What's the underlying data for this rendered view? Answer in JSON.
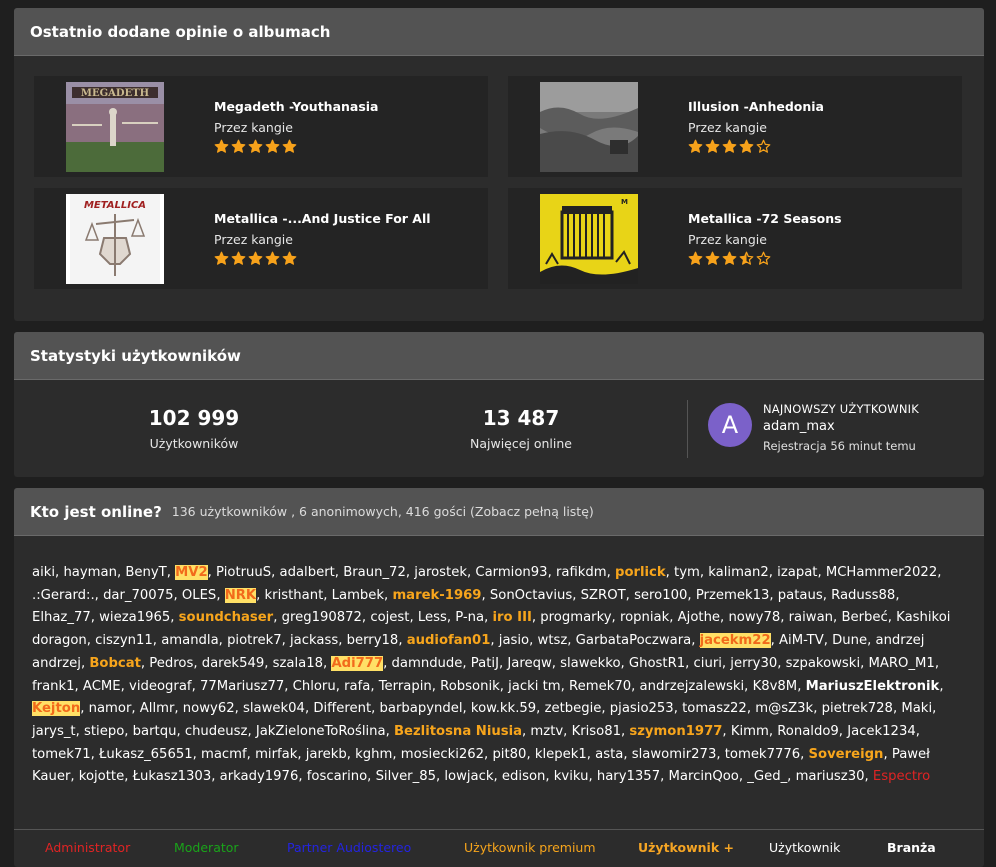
{
  "reviews": {
    "title": "Ostatnio dodane opinie o albumach",
    "items": [
      {
        "title": "Megadeth -Youthanasia",
        "author": "Przez kangie",
        "rating": 5
      },
      {
        "title": "Illusion -Anhedonia",
        "author": "Przez kangie",
        "rating": 4
      },
      {
        "title": "Metallica -...And Justice For All",
        "author": "Przez kangie",
        "rating": 5
      },
      {
        "title": "Metallica -72 Seasons",
        "author": "Przez kangie",
        "rating": 3.5
      }
    ]
  },
  "stats": {
    "title": "Statystyki użytkowników",
    "users_count": "102 999",
    "users_label": "Użytkowników",
    "online_max": "13 487",
    "online_max_label": "Najwięcej online",
    "newest_label": "NAJNOWSZY UŻYTKOWNIK",
    "newest_initial": "A",
    "newest_name": "adam_max",
    "newest_registered": "Rejestracja 56 minut temu"
  },
  "online": {
    "title": "Kto jest online?",
    "summary": "136 użytkowników , 6 anonimowych, 416 gości (Zobacz pełną listę)",
    "users": [
      {
        "n": "aiki"
      },
      {
        "n": "hayman"
      },
      {
        "n": "BenyT"
      },
      {
        "n": "MV2",
        "t": "premium hl"
      },
      {
        "n": "PiotruuS"
      },
      {
        "n": "adalbert"
      },
      {
        "n": "Braun_72"
      },
      {
        "n": "jarostek"
      },
      {
        "n": "Carmion93"
      },
      {
        "n": "rafikdm"
      },
      {
        "n": "porlick",
        "t": "premium"
      },
      {
        "n": "tym"
      },
      {
        "n": "kaliman2"
      },
      {
        "n": "izapat"
      },
      {
        "n": "MCHammer2022"
      },
      {
        "n": ".:Gerard:."
      },
      {
        "n": "dar_70075"
      },
      {
        "n": "OLES"
      },
      {
        "n": "NRK",
        "t": "premium hl"
      },
      {
        "n": "kristhant"
      },
      {
        "n": "Lambek"
      },
      {
        "n": "marek-1969",
        "t": "premium"
      },
      {
        "n": "SonOctavius"
      },
      {
        "n": "SZROT"
      },
      {
        "n": "sero100"
      },
      {
        "n": "Przemek13"
      },
      {
        "n": "pataus"
      },
      {
        "n": "Raduss88"
      },
      {
        "n": "Elhaz_77"
      },
      {
        "n": "wieza1965"
      },
      {
        "n": "soundchaser",
        "t": "premium"
      },
      {
        "n": "greg190872"
      },
      {
        "n": "cojest"
      },
      {
        "n": "Less"
      },
      {
        "n": "P-na"
      },
      {
        "n": "iro III",
        "t": "premium"
      },
      {
        "n": "progmarky"
      },
      {
        "n": "ropniak"
      },
      {
        "n": "Ajothe"
      },
      {
        "n": "nowy78"
      },
      {
        "n": "raiwan"
      },
      {
        "n": "Berbeć"
      },
      {
        "n": "Kashikoi doragon"
      },
      {
        "n": "ciszyn11"
      },
      {
        "n": "amandla"
      },
      {
        "n": "piotrek7"
      },
      {
        "n": "jackass"
      },
      {
        "n": "berry18"
      },
      {
        "n": "audiofan01",
        "t": "premium"
      },
      {
        "n": "jasio"
      },
      {
        "n": "wtsz"
      },
      {
        "n": "GarbataPoczwara"
      },
      {
        "n": "jacekm22",
        "t": "premium hl"
      },
      {
        "n": "AiM-TV"
      },
      {
        "n": "Dune"
      },
      {
        "n": "andrzej andrzej"
      },
      {
        "n": "Bobcat",
        "t": "premium"
      },
      {
        "n": "Pedros"
      },
      {
        "n": "darek549"
      },
      {
        "n": "szala18"
      },
      {
        "n": "Adi777",
        "t": "premium hl"
      },
      {
        "n": "damndude"
      },
      {
        "n": "PatiJ"
      },
      {
        "n": "Jareqw"
      },
      {
        "n": "slawekko"
      },
      {
        "n": "GhostR1"
      },
      {
        "n": "ciuri"
      },
      {
        "n": "jerry30"
      },
      {
        "n": "szpakowski"
      },
      {
        "n": "MARO_M1"
      },
      {
        "n": "frank1"
      },
      {
        "n": "ACME"
      },
      {
        "n": "videograf"
      },
      {
        "n": "77Mariusz77"
      },
      {
        "n": "Chloru"
      },
      {
        "n": "rafa"
      },
      {
        "n": "Terrapin"
      },
      {
        "n": "Robsonik"
      },
      {
        "n": "jacki tm"
      },
      {
        "n": "Remek70"
      },
      {
        "n": "andrzejzalewski"
      },
      {
        "n": "K8v8M"
      },
      {
        "n": "MariuszElektronik",
        "t": "strong"
      },
      {
        "n": "Kejton",
        "t": "premium hl"
      },
      {
        "n": "namor"
      },
      {
        "n": "Allmr"
      },
      {
        "n": "nowy62"
      },
      {
        "n": "slawek04"
      },
      {
        "n": "Different"
      },
      {
        "n": "barbapyndel"
      },
      {
        "n": "kow.kk.59"
      },
      {
        "n": "zetbegie"
      },
      {
        "n": "pjasio253"
      },
      {
        "n": "tomasz22"
      },
      {
        "n": "m@sZ3k"
      },
      {
        "n": "pietrek728"
      },
      {
        "n": "Maki"
      },
      {
        "n": "jarys_t"
      },
      {
        "n": "stiepo"
      },
      {
        "n": "bartqu"
      },
      {
        "n": "chudeusz"
      },
      {
        "n": "JakZieloneToRoślina"
      },
      {
        "n": "Bezlitosna Niusia",
        "t": "premium"
      },
      {
        "n": "mztv"
      },
      {
        "n": "Kriso81"
      },
      {
        "n": "szymon1977",
        "t": "premium"
      },
      {
        "n": "Kimm"
      },
      {
        "n": "Ronaldo9"
      },
      {
        "n": "Jacek1234"
      },
      {
        "n": "tomek71"
      },
      {
        "n": "Łukasz_65651"
      },
      {
        "n": "macmf"
      },
      {
        "n": "mirfak"
      },
      {
        "n": "jarekb"
      },
      {
        "n": "kghm"
      },
      {
        "n": "mosiecki262"
      },
      {
        "n": "pit80"
      },
      {
        "n": "klepek1"
      },
      {
        "n": "asta"
      },
      {
        "n": "slawomir273"
      },
      {
        "n": "tomek7776"
      },
      {
        "n": "Sovereign",
        "t": "premium"
      },
      {
        "n": "Paweł Kauer"
      },
      {
        "n": "kojotte"
      },
      {
        "n": "Łukasz1303"
      },
      {
        "n": "arkady1976"
      },
      {
        "n": "foscarino"
      },
      {
        "n": "Silver_85"
      },
      {
        "n": "lowjack"
      },
      {
        "n": "edison"
      },
      {
        "n": "kviku"
      },
      {
        "n": "hary1357"
      },
      {
        "n": "MarcinQoo"
      },
      {
        "n": "_Ged_"
      },
      {
        "n": "mariusz30"
      },
      {
        "n": "Espectro",
        "t": "admin"
      }
    ],
    "legend": [
      {
        "label": "Administrator",
        "color": "#e02424"
      },
      {
        "label": "Moderator",
        "color": "#1aa31a"
      },
      {
        "label": "Partner Audiostereo",
        "color": "#2424e0"
      },
      {
        "label": "Użytkownik premium",
        "color": "#f7a51c"
      },
      {
        "label": "Użytkownik +",
        "color": "#f5a524"
      },
      {
        "label": "Użytkownik",
        "color": "#ffffff"
      },
      {
        "label": "Branża",
        "color": "#ffffff"
      }
    ]
  },
  "colors": {
    "star": "#f7a21b",
    "premium": "#f7a51c",
    "admin": "#e02424",
    "avatar": "#7b61c9"
  }
}
